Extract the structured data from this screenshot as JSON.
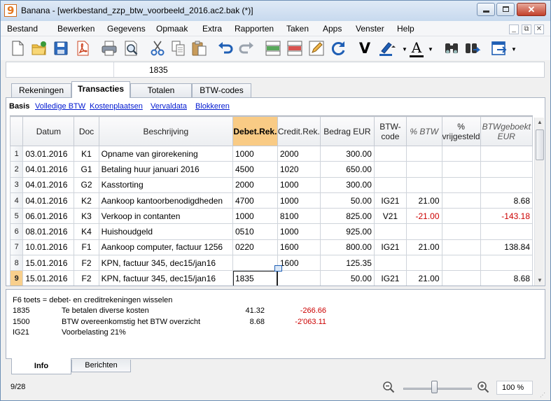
{
  "window": {
    "app_icon_glyph": "9",
    "title": "Banana - [werkbestand_zzp_btw_voorbeeld_2016.ac2.bak (*)]",
    "close_glyph": "✕"
  },
  "menu": [
    "Bestand",
    "Bewerken",
    "Gegevens",
    "Opmaak",
    "Extra",
    "Rapporten",
    "Taken",
    "Apps",
    "Venster",
    "Help"
  ],
  "mdi_buttons": [
    "_",
    "⧉",
    "✕"
  ],
  "toolbar": {
    "icons": [
      "new-file-icon",
      "open-folder-icon",
      "save-icon",
      "pdf-icon",
      "print-icon",
      "print-preview-icon",
      "cut-icon",
      "copy-icon",
      "paste-icon",
      "undo-icon",
      "redo-icon",
      "add-rows-icon",
      "delete-rows-icon",
      "edit-pen-icon",
      "recalculate-icon",
      "check-icon",
      "highlight-icon",
      "font-color-icon",
      "search-icon",
      "navigate-icon"
    ],
    "check_label": "V",
    "font_color_label": "A",
    "accent_red": "#cc0000",
    "accent_blue": "#1f5fb5"
  },
  "cellbar": {
    "value": "1835"
  },
  "tabs": [
    "Rekeningen",
    "Transacties",
    "Totalen",
    "BTW-codes"
  ],
  "active_tab": "Transacties",
  "subviews": [
    "Basis",
    "Volledige BTW",
    "Kostenplaatsen",
    "Vervaldata",
    "Blokkeren"
  ],
  "grid": {
    "columns": [
      "",
      "Datum",
      "Doc",
      "Beschrijving",
      "Debet.Rek.",
      "Credit.Rek.",
      "Bedrag EUR",
      "BTW-code",
      "% BTW",
      "% vrijgesteld",
      "BTWgeboekt EUR"
    ],
    "rows": [
      {
        "n": "1",
        "datum": "03.01.2016",
        "doc": "K1",
        "beschrijving": "Opname van girorekening",
        "debet": "1000",
        "credit": "2000",
        "bedrag": "300.00",
        "btwcode": "",
        "pct": "",
        "vrij": "",
        "geboekt": ""
      },
      {
        "n": "2",
        "datum": "04.01.2016",
        "doc": "G1",
        "beschrijving": "Betaling huur januari 2016",
        "debet": "4500",
        "credit": "1020",
        "bedrag": "650.00",
        "btwcode": "",
        "pct": "",
        "vrij": "",
        "geboekt": ""
      },
      {
        "n": "3",
        "datum": "04.01.2016",
        "doc": "G2",
        "beschrijving": "Kasstorting",
        "debet": "2000",
        "credit": "1000",
        "bedrag": "300.00",
        "btwcode": "",
        "pct": "",
        "vrij": "",
        "geboekt": ""
      },
      {
        "n": "4",
        "datum": "04.01.2016",
        "doc": "K2",
        "beschrijving": "Aankoop kantoorbenodigdheden",
        "debet": "4700",
        "credit": "1000",
        "bedrag": "50.00",
        "btwcode": "IG21",
        "pct": "21.00",
        "vrij": "",
        "geboekt": "8.68"
      },
      {
        "n": "5",
        "datum": "06.01.2016",
        "doc": "K3",
        "beschrijving": "Verkoop in contanten",
        "debet": "1000",
        "credit": "8100",
        "bedrag": "825.00",
        "btwcode": "V21",
        "pct": "-21.00",
        "vrij": "",
        "geboekt": "-143.18"
      },
      {
        "n": "6",
        "datum": "08.01.2016",
        "doc": "K4",
        "beschrijving": "Huishoudgeld",
        "debet": "0510",
        "credit": "1000",
        "bedrag": "925.00",
        "btwcode": "",
        "pct": "",
        "vrij": "",
        "geboekt": ""
      },
      {
        "n": "7",
        "datum": "10.01.2016",
        "doc": "F1",
        "beschrijving": "Aankoop computer, factuur 1256",
        "debet": "0220",
        "credit": "1600",
        "bedrag": "800.00",
        "btwcode": "IG21",
        "pct": "21.00",
        "vrij": "",
        "geboekt": "138.84"
      },
      {
        "n": "8",
        "datum": "15.01.2016",
        "doc": "F2",
        "beschrijving": "KPN, factuur 345, dec15/jan16",
        "debet": "",
        "credit": "1600",
        "bedrag": "125.35",
        "btwcode": "",
        "pct": "",
        "vrij": "",
        "geboekt": ""
      },
      {
        "n": "9",
        "datum": "15.01.2016",
        "doc": "F2",
        "beschrijving": "KPN, factuur 345, dec15/jan16",
        "debet": "1835",
        "credit": "",
        "bedrag": "50.00",
        "btwcode": "IG21",
        "pct": "21.00",
        "vrij": "",
        "geboekt": "8.68"
      }
    ]
  },
  "info": {
    "hint": "F6 toets = debet- en creditrekeningen wisselen",
    "lines": [
      {
        "a": "1835",
        "b": "Te betalen diverse kosten",
        "c": "41.32",
        "d": "-266.66"
      },
      {
        "a": "1500",
        "b": "BTW overeenkomstig het BTW overzicht",
        "c": "8.68",
        "d": "-2'063.11"
      },
      {
        "a": "IG21",
        "b": "Voorbelasting 21%",
        "c": "",
        "d": ""
      }
    ]
  },
  "bottom_tabs": [
    "Info",
    "Berichten"
  ],
  "status": {
    "position": "9/28",
    "zoom": "100 %",
    "zoom_level_percent": 100
  }
}
